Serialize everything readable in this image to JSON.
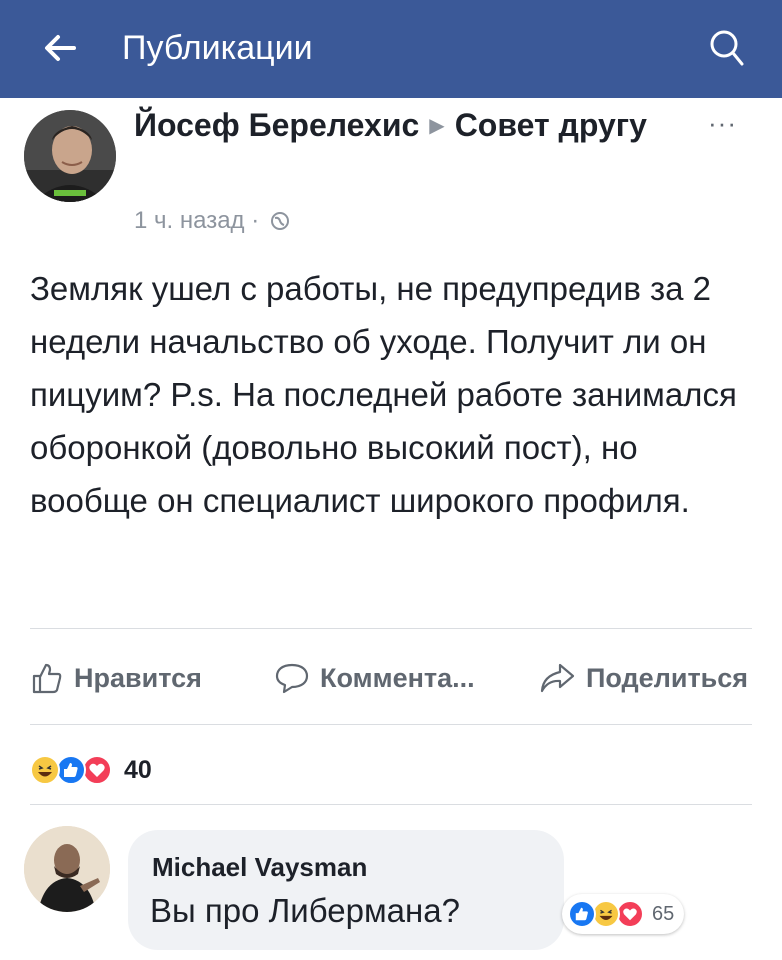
{
  "topbar": {
    "title": "Публикации",
    "back_icon": "back-arrow-icon",
    "search_icon": "search-icon",
    "background": "#3b5998"
  },
  "post": {
    "author": "Йосеф Берелехис",
    "group": "Совет другу",
    "time": "1 ч. назад",
    "separator": "·",
    "more": "···",
    "text": "Земляк ушел с работы, не предупредив за 2 недели начальство об уходе. Получит ли он пицуим? P.s. На последней работе занимался оборонкой (довольно высокий пост), но вообще он специалист широкого профиля."
  },
  "actions": {
    "like": "Нравится",
    "comment": "Коммента...",
    "share": "Поделиться"
  },
  "reactions": {
    "count": "40",
    "icons": [
      "haha-icon",
      "like-icon",
      "love-icon"
    ]
  },
  "comment": {
    "author": "Michael Vaysman",
    "text": "Вы про Либермана?",
    "reaction_count": "65",
    "reaction_icons": [
      "like-icon",
      "haha-icon",
      "love-icon"
    ]
  }
}
